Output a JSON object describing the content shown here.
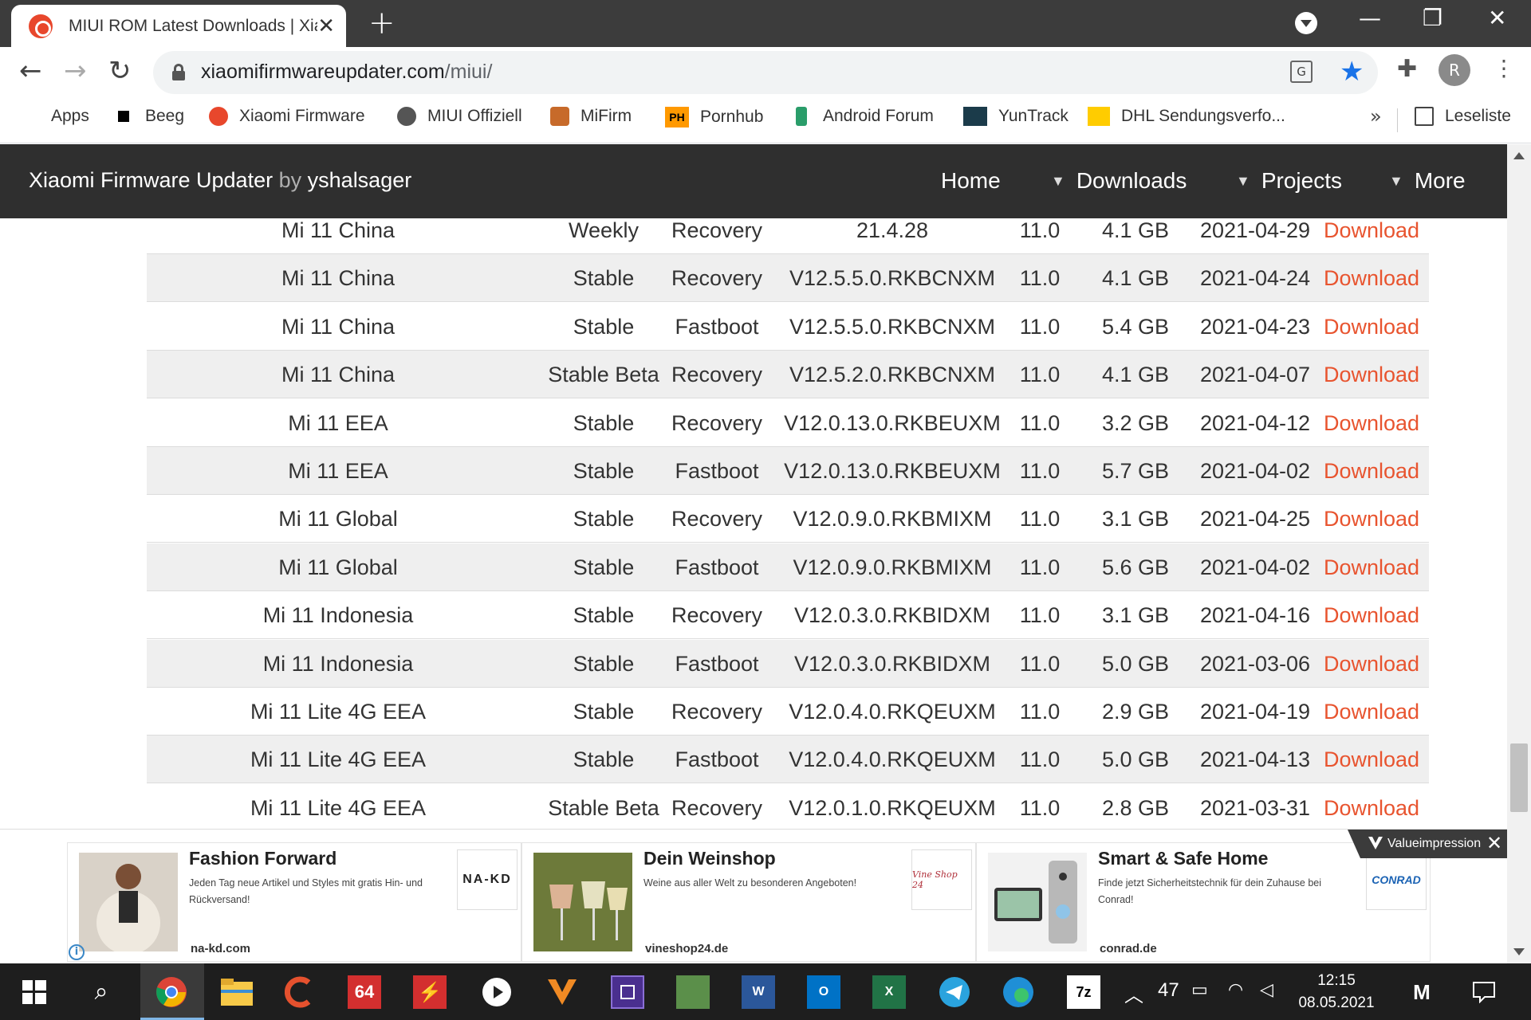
{
  "browser": {
    "tab_title": "MIUI ROM Latest Downloads | Xiaomi Firmware Updater",
    "url_domain": "xiaomifirmwareupdater.com",
    "url_path": "/miui/",
    "profile_initial": "R",
    "bookmarks": [
      {
        "label": "Apps",
        "icon": "apps-grid-icon"
      },
      {
        "label": "Beeg",
        "icon": "black-square-icon"
      },
      {
        "label": "Xiaomi Firmware",
        "icon": "xiaomi-firmware-icon"
      },
      {
        "label": "MIUI Offiziell",
        "icon": "globe-icon"
      },
      {
        "label": "MiFirm",
        "icon": "mifirm-icon"
      },
      {
        "label": "Pornhub",
        "icon": "ph-icon"
      },
      {
        "label": "Android Forum",
        "icon": "android-forum-icon"
      },
      {
        "label": "YunTrack",
        "icon": "yuntrack-icon"
      },
      {
        "label": "DHL Sendungsverfo...",
        "icon": "dhl-icon"
      }
    ],
    "reading_list": "Leseliste",
    "more_bookmarks": "»"
  },
  "site": {
    "brand_name": "Xiaomi Firmware Updater",
    "brand_by": "by",
    "brand_author": "yshalsager",
    "nav": [
      {
        "label": "Home"
      },
      {
        "label": "Downloads"
      },
      {
        "label": "Projects"
      },
      {
        "label": "More"
      }
    ]
  },
  "table": {
    "rows": [
      {
        "device": "Mi 11 China",
        "branch": "Weekly",
        "type": "Recovery",
        "version": "21.4.28",
        "android": "11.0",
        "size": "4.1 GB",
        "date": "2021-04-29",
        "link": "Download"
      },
      {
        "device": "Mi 11 China",
        "branch": "Stable",
        "type": "Recovery",
        "version": "V12.5.5.0.RKBCNXM",
        "android": "11.0",
        "size": "4.1 GB",
        "date": "2021-04-24",
        "link": "Download"
      },
      {
        "device": "Mi 11 China",
        "branch": "Stable",
        "type": "Fastboot",
        "version": "V12.5.5.0.RKBCNXM",
        "android": "11.0",
        "size": "5.4 GB",
        "date": "2021-04-23",
        "link": "Download"
      },
      {
        "device": "Mi 11 China",
        "branch": "Stable Beta",
        "type": "Recovery",
        "version": "V12.5.2.0.RKBCNXM",
        "android": "11.0",
        "size": "4.1 GB",
        "date": "2021-04-07",
        "link": "Download"
      },
      {
        "device": "Mi 11 EEA",
        "branch": "Stable",
        "type": "Recovery",
        "version": "V12.0.13.0.RKBEUXM",
        "android": "11.0",
        "size": "3.2 GB",
        "date": "2021-04-12",
        "link": "Download"
      },
      {
        "device": "Mi 11 EEA",
        "branch": "Stable",
        "type": "Fastboot",
        "version": "V12.0.13.0.RKBEUXM",
        "android": "11.0",
        "size": "5.7 GB",
        "date": "2021-04-02",
        "link": "Download"
      },
      {
        "device": "Mi 11 Global",
        "branch": "Stable",
        "type": "Recovery",
        "version": "V12.0.9.0.RKBMIXM",
        "android": "11.0",
        "size": "3.1 GB",
        "date": "2021-04-25",
        "link": "Download"
      },
      {
        "device": "Mi 11 Global",
        "branch": "Stable",
        "type": "Fastboot",
        "version": "V12.0.9.0.RKBMIXM",
        "android": "11.0",
        "size": "5.6 GB",
        "date": "2021-04-02",
        "link": "Download"
      },
      {
        "device": "Mi 11 Indonesia",
        "branch": "Stable",
        "type": "Recovery",
        "version": "V12.0.3.0.RKBIDXM",
        "android": "11.0",
        "size": "3.1 GB",
        "date": "2021-04-16",
        "link": "Download"
      },
      {
        "device": "Mi 11 Indonesia",
        "branch": "Stable",
        "type": "Fastboot",
        "version": "V12.0.3.0.RKBIDXM",
        "android": "11.0",
        "size": "5.0 GB",
        "date": "2021-03-06",
        "link": "Download"
      },
      {
        "device": "Mi 11 Lite 4G EEA",
        "branch": "Stable",
        "type": "Recovery",
        "version": "V12.0.4.0.RKQEUXM",
        "android": "11.0",
        "size": "2.9 GB",
        "date": "2021-04-19",
        "link": "Download"
      },
      {
        "device": "Mi 11 Lite 4G EEA",
        "branch": "Stable",
        "type": "Fastboot",
        "version": "V12.0.4.0.RKQEUXM",
        "android": "11.0",
        "size": "5.0 GB",
        "date": "2021-04-13",
        "link": "Download"
      },
      {
        "device": "Mi 11 Lite 4G EEA",
        "branch": "Stable Beta",
        "type": "Recovery",
        "version": "V12.0.1.0.RKQEUXM",
        "android": "11.0",
        "size": "2.8 GB",
        "date": "2021-03-31",
        "link": "Download"
      }
    ]
  },
  "ads": {
    "network": "Valueimpression",
    "items": [
      {
        "title": "Fashion Forward",
        "description": "Jeden Tag neue Artikel und Styles mit gratis Hin- und Rückversand!",
        "domain": "na-kd.com",
        "logo_text": "NA-KD"
      },
      {
        "title": "Dein Weinshop",
        "description": "Weine aus aller Welt zu besonderen Angeboten!",
        "domain": "vineshop24.de",
        "logo_text": "Vine Shop 24"
      },
      {
        "title": "Smart & Safe Home",
        "description": "Finde jetzt Sicherheitstechnik für dein Zuhause bei Conrad!",
        "domain": "conrad.de",
        "logo_text": "CONRAD"
      }
    ]
  },
  "taskbar": {
    "app_64_label": "64",
    "app_7z_label": "7z",
    "tray_number": "47",
    "time": "12:15",
    "date": "08.05.2021"
  },
  "colors": {
    "download_link": "#e8542f",
    "site_header_bg": "#2f2f2f",
    "star_blue": "#1a73e8"
  }
}
